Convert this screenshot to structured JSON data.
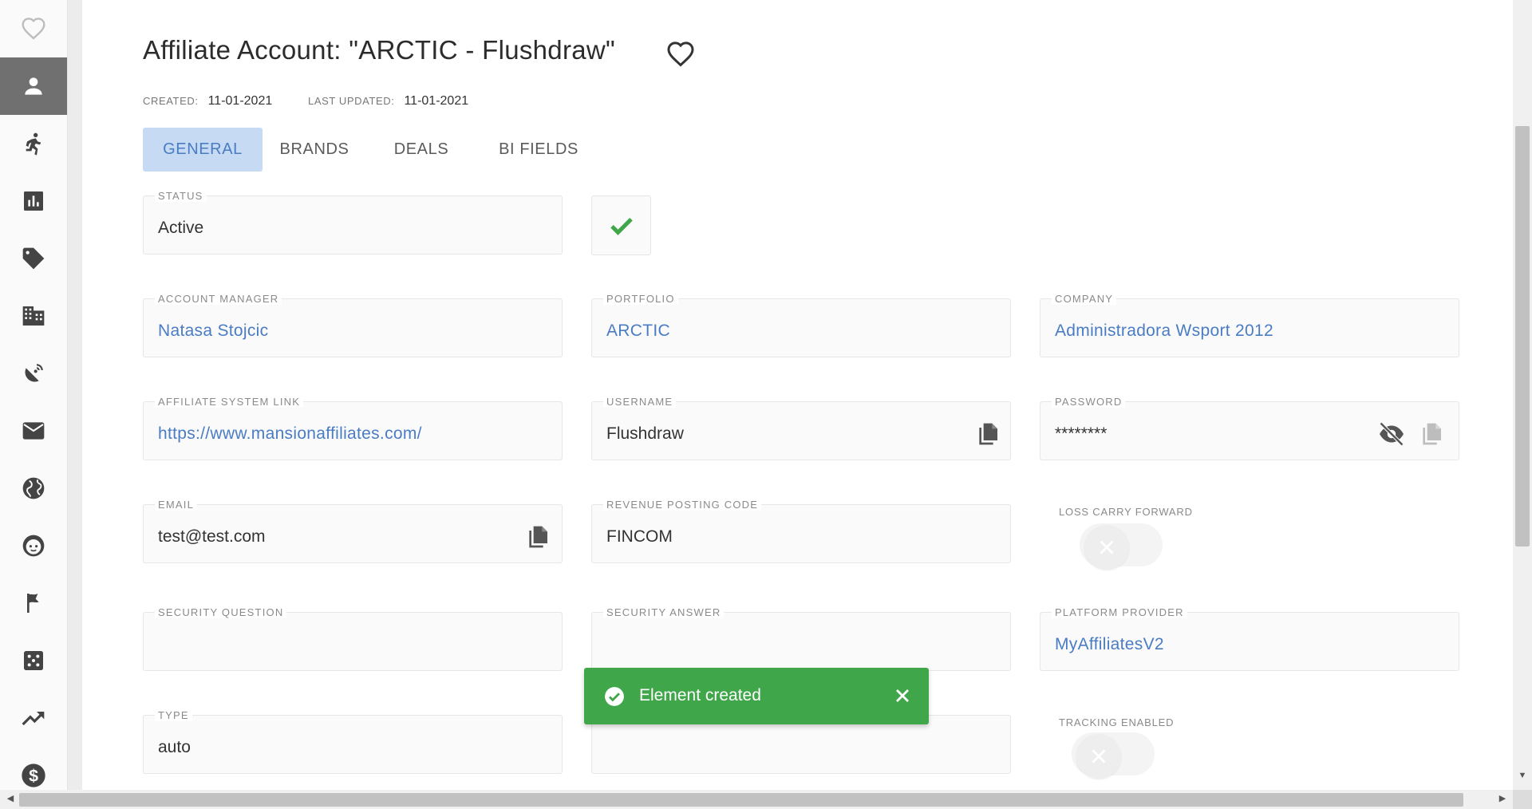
{
  "sidebar": {
    "items": [
      {
        "icon": "heart-outline-icon"
      },
      {
        "icon": "person-icon",
        "active": true
      },
      {
        "icon": "running-person-icon"
      },
      {
        "icon": "bar-chart-icon"
      },
      {
        "icon": "tag-icon"
      },
      {
        "icon": "building-icon"
      },
      {
        "icon": "satellite-dish-icon"
      },
      {
        "icon": "mail-icon"
      },
      {
        "icon": "globe-icon"
      },
      {
        "icon": "face-icon"
      },
      {
        "icon": "flag-icon"
      },
      {
        "icon": "dice-icon"
      },
      {
        "icon": "trending-up-icon"
      },
      {
        "icon": "dollar-icon"
      }
    ]
  },
  "header": {
    "title": "Affiliate Account: \"ARCTIC - Flushdraw\"",
    "created_label": "CREATED:",
    "created_value": "11-01-2021",
    "updated_label": "LAST UPDATED:",
    "updated_value": "11-01-2021"
  },
  "tabs": [
    {
      "label": "GENERAL",
      "active": true
    },
    {
      "label": "BRANDS"
    },
    {
      "label": "DEALS"
    },
    {
      "label": "BI FIELDS"
    }
  ],
  "fields": {
    "status": {
      "label": "STATUS",
      "value": "Active"
    },
    "account_manager": {
      "label": "ACCOUNT MANAGER",
      "value": "Natasa Stojcic"
    },
    "portfolio": {
      "label": "PORTFOLIO",
      "value": "ARCTIC"
    },
    "company": {
      "label": "COMPANY",
      "value": "Administradora Wsport 2012"
    },
    "affiliate_system_link": {
      "label": "AFFILIATE SYSTEM LINK",
      "value": "https://www.mansionaffiliates.com/"
    },
    "username": {
      "label": "USERNAME",
      "value": "Flushdraw"
    },
    "password": {
      "label": "PASSWORD",
      "value": "********"
    },
    "email": {
      "label": "EMAIL",
      "value": "test@test.com"
    },
    "revenue_posting_code": {
      "label": "REVENUE POSTING CODE",
      "value": "FINCOM"
    },
    "loss_carry_forward": {
      "label": "LOSS CARRY FORWARD",
      "enabled": false
    },
    "security_question": {
      "label": "SECURITY QUESTION",
      "value": ""
    },
    "security_answer": {
      "label": "SECURITY ANSWER",
      "value": ""
    },
    "platform_provider": {
      "label": "PLATFORM PROVIDER",
      "value": "MyAffiliatesV2"
    },
    "type": {
      "label": "TYPE",
      "value": "auto"
    },
    "unlabeled_middle": {
      "value": ""
    },
    "tracking_enabled": {
      "label": "TRACKING ENABLED",
      "enabled": false
    }
  },
  "toast": {
    "message": "Element created"
  },
  "colors": {
    "accent": "#4a7cc4",
    "tab_active_bg": "#c6daf3",
    "success": "#3fa64a",
    "sidebar_active": "#707070"
  }
}
